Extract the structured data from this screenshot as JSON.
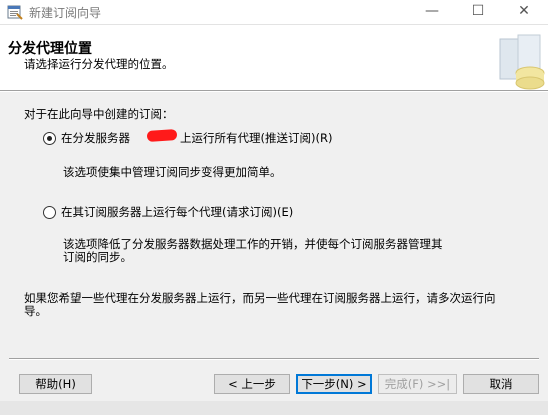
{
  "window": {
    "title": "新建订阅向导",
    "minimize_icon": "—",
    "maximize_icon": "☐",
    "close_icon": "✕"
  },
  "header": {
    "title": "分发代理位置",
    "subtitle": "请选择运行分发代理的位置。"
  },
  "body": {
    "question": "对于在此向导中创建的订阅：",
    "options": [
      {
        "label_prefix": "在分发服务器",
        "label_suffix": "上运行所有代理(推送订阅)(R)",
        "selected": true,
        "description": "该选项使集中管理订阅同步变得更加简单。"
      },
      {
        "label": "在其订阅服务器上运行每个代理(请求订阅)(E)",
        "selected": false,
        "description_line1": "该选项降低了分发服务器数据处理工作的开销，并使每个订阅服务器管理其",
        "description_line2": "订阅的同步。"
      }
    ],
    "note_line1": "如果您希望一些代理在分发服务器上运行，而另一些代理在订阅服务器上运行，请多次运行向",
    "note_line2": "导。"
  },
  "footer": {
    "help": "帮助(H)",
    "back": "< 上一步",
    "next": "下一步(N) >",
    "finish": "完成(F) >>|",
    "cancel": "取消"
  }
}
